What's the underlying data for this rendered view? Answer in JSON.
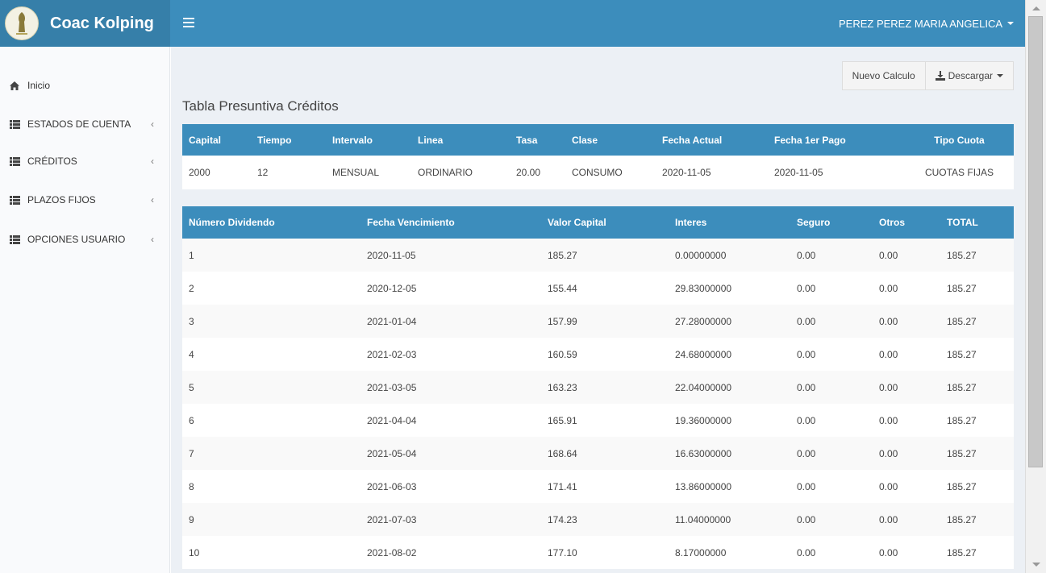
{
  "header": {
    "brand": "Coac Kolping",
    "user_name": "PEREZ PEREZ MARIA ANGELICA",
    "colors": {
      "topbar": "#3c8dbc",
      "brand_bg": "#367fa9"
    }
  },
  "sidebar": {
    "items": [
      {
        "label": "Inicio",
        "icon": "home-icon"
      },
      {
        "label": "ESTADOS DE CUENTA",
        "icon": "list-icon"
      },
      {
        "label": "CRÉDITOS",
        "icon": "list-icon"
      },
      {
        "label": "PLAZOS FIJOS",
        "icon": "list-icon"
      },
      {
        "label": "OPCIONES USUARIO",
        "icon": "list-icon"
      }
    ]
  },
  "toolbar": {
    "nuevo_calculo": "Nuevo Calculo",
    "descargar": "Descargar"
  },
  "page_title": "Tabla Presuntiva Créditos",
  "summary": {
    "headers": [
      "Capital",
      "Tiempo",
      "Intervalo",
      "Linea",
      "Tasa",
      "Clase",
      "Fecha Actual",
      "Fecha 1er Pago",
      "Tipo Cuota"
    ],
    "row": [
      "2000",
      "12",
      "MENSUAL",
      "ORDINARIO",
      "20.00",
      "CONSUMO",
      "2020-11-05",
      "2020-11-05",
      "CUOTAS FIJAS"
    ]
  },
  "amortization": {
    "headers": [
      "Número Dividendo",
      "Fecha Vencimiento",
      "Valor Capital",
      "Interes",
      "Seguro",
      "Otros",
      "TOTAL"
    ],
    "rows": [
      [
        "1",
        "2020-11-05",
        "185.27",
        "0.00000000",
        "0.00",
        "0.00",
        "185.27"
      ],
      [
        "2",
        "2020-12-05",
        "155.44",
        "29.83000000",
        "0.00",
        "0.00",
        "185.27"
      ],
      [
        "3",
        "2021-01-04",
        "157.99",
        "27.28000000",
        "0.00",
        "0.00",
        "185.27"
      ],
      [
        "4",
        "2021-02-03",
        "160.59",
        "24.68000000",
        "0.00",
        "0.00",
        "185.27"
      ],
      [
        "5",
        "2021-03-05",
        "163.23",
        "22.04000000",
        "0.00",
        "0.00",
        "185.27"
      ],
      [
        "6",
        "2021-04-04",
        "165.91",
        "19.36000000",
        "0.00",
        "0.00",
        "185.27"
      ],
      [
        "7",
        "2021-05-04",
        "168.64",
        "16.63000000",
        "0.00",
        "0.00",
        "185.27"
      ],
      [
        "8",
        "2021-06-03",
        "171.41",
        "13.86000000",
        "0.00",
        "0.00",
        "185.27"
      ],
      [
        "9",
        "2021-07-03",
        "174.23",
        "11.04000000",
        "0.00",
        "0.00",
        "185.27"
      ],
      [
        "10",
        "2021-08-02",
        "177.10",
        "8.17000000",
        "0.00",
        "0.00",
        "185.27"
      ]
    ]
  }
}
